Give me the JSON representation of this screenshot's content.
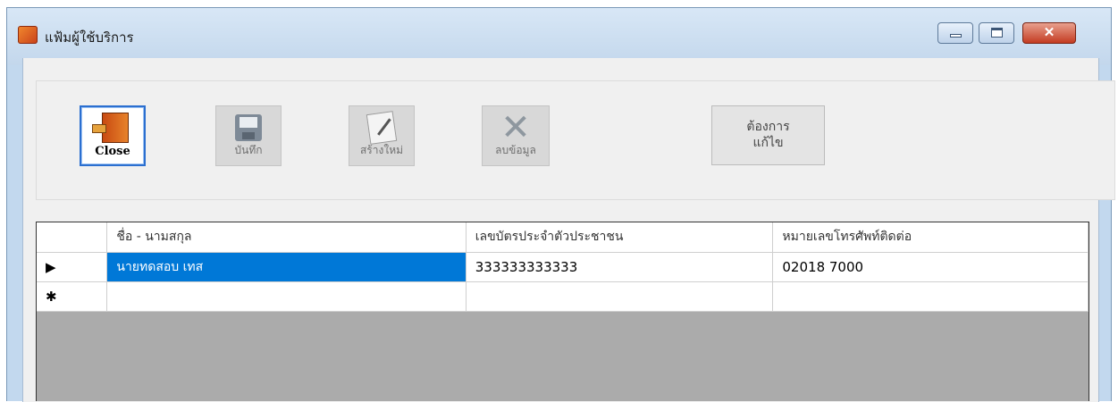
{
  "window": {
    "title": "แฟ้มผู้ใช้บริการ",
    "controls": {
      "minimize": "",
      "maximize": "",
      "close": "✕"
    }
  },
  "toolbar": {
    "close_label": "Close",
    "save_label": "บันทึก",
    "new_label": "สร้างใหม่",
    "delete_label": "ลบข้อมูล",
    "edit_label": "ต้องการ\nแก้ไข"
  },
  "grid": {
    "columns": [
      "ชื่อ - นามสกุล",
      "เลขบัตรประจำตัวประชาชน",
      "หมายเลขโทรศัพท์ติดต่อ"
    ],
    "rows": [
      {
        "marker": "▶",
        "name": "นายทดสอบ เทส",
        "id_card": "333333333333",
        "phone": "02018 7000"
      }
    ],
    "new_row_marker": "✱"
  }
}
